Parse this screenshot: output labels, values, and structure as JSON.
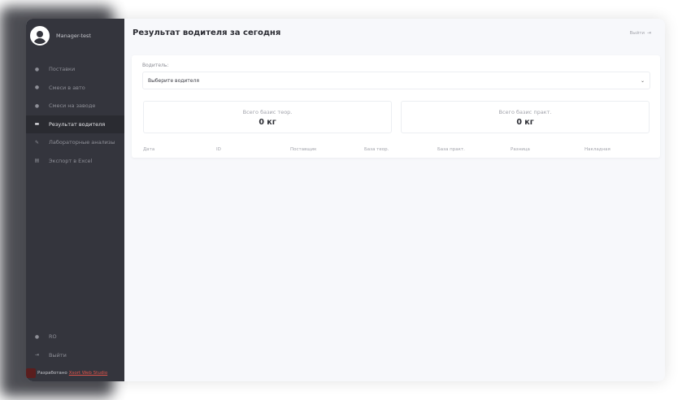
{
  "profile": {
    "name": "Manager-test"
  },
  "menu": [
    {
      "label": "Поставки",
      "icon": "circle-icon",
      "glyph": "●",
      "active": false
    },
    {
      "label": "Смеси в авто",
      "icon": "circle-icon",
      "glyph": "●",
      "active": false
    },
    {
      "label": "Смеси на заводе",
      "icon": "circle-icon",
      "glyph": "●",
      "active": false
    },
    {
      "label": "Результат водителя",
      "icon": "card-icon",
      "glyph": "▬",
      "active": true
    },
    {
      "label": "Лабораторные анализы",
      "icon": "pen-icon",
      "glyph": "✎",
      "active": false
    },
    {
      "label": "Экспорт в Excel",
      "icon": "archive-icon",
      "glyph": "▤",
      "active": false
    }
  ],
  "bottom_menu": [
    {
      "label": "RO",
      "icon": "globe-icon",
      "glyph": "●"
    },
    {
      "label": "Выйти",
      "icon": "logout-icon",
      "glyph": "⇥"
    }
  ],
  "credit": {
    "prefix": "Разработано",
    "link": "Xsort Web Studio"
  },
  "header": {
    "title": "Результат водителя за сегодня",
    "logout": "Выйти"
  },
  "filter": {
    "label": "Водитель:",
    "placeholder": "Выберите водителя"
  },
  "stats": {
    "theory_label": "Всего базис теор.",
    "theory_value": "0 кг",
    "practice_label": "Всего базис практ.",
    "practice_value": "0 кг"
  },
  "table": {
    "columns": [
      "Дата",
      "ID",
      "Поставщик",
      "База теор.",
      "База практ.",
      "Разница",
      "Накладная"
    ]
  }
}
